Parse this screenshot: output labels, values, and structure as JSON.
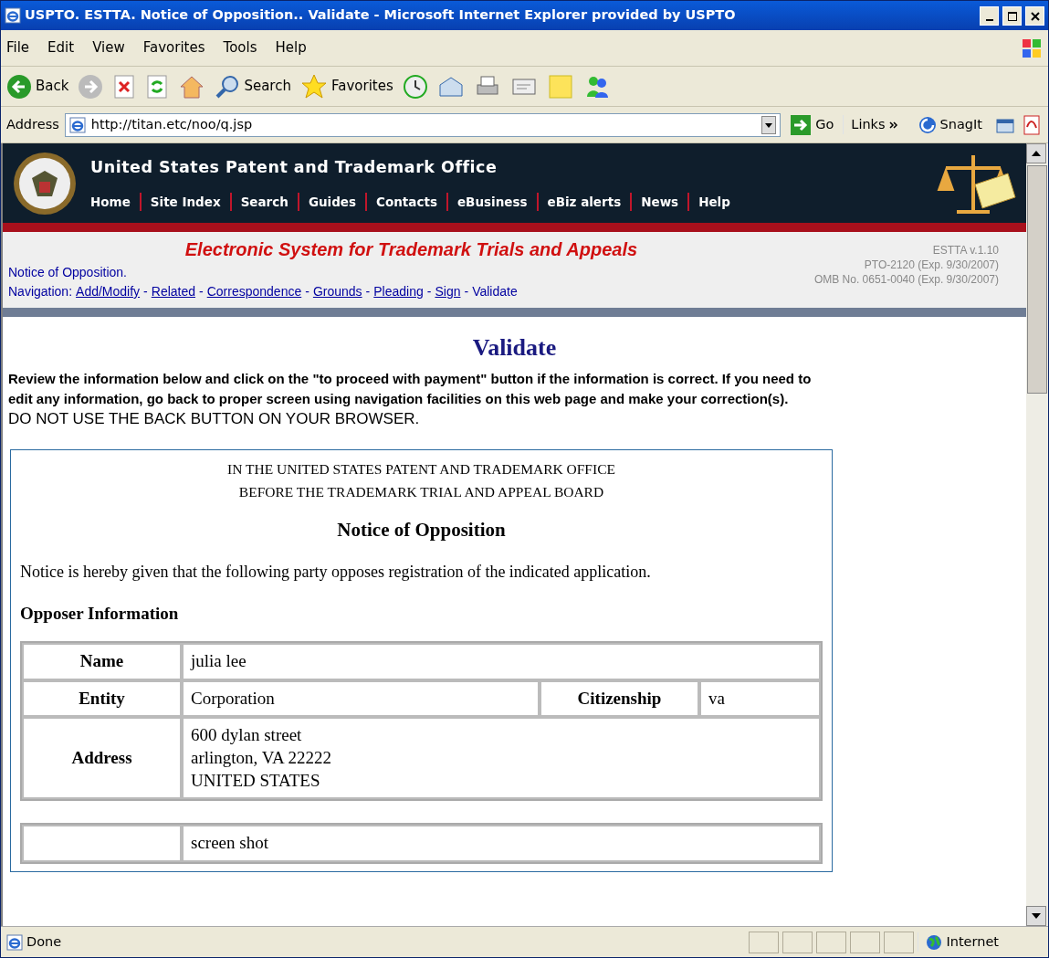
{
  "window": {
    "title": "USPTO. ESTTA. Notice of Opposition.. Validate - Microsoft Internet Explorer provided by USPTO"
  },
  "menu": [
    "File",
    "Edit",
    "View",
    "Favorites",
    "Tools",
    "Help"
  ],
  "toolbar": {
    "back": "Back",
    "search": "Search",
    "favorites": "Favorites"
  },
  "address_bar": {
    "label": "Address",
    "url": "http://titan.etc/noo/q.jsp",
    "go": "Go",
    "links": "Links",
    "snagit": "SnagIt"
  },
  "site_header": {
    "title": "United States Patent and Trademark Office",
    "nav": [
      "Home",
      "Site Index",
      "Search",
      "Guides",
      "Contacts",
      "eBusiness",
      "eBiz alerts",
      "News",
      "Help"
    ]
  },
  "banner": {
    "system_title": "Electronic System for Trademark Trials and Appeals",
    "form_name": "Notice of Opposition.",
    "nav_label": "Navigation:",
    "separator": "-",
    "nav": [
      {
        "label": "Add/Modify",
        "link": true
      },
      {
        "label": "Related",
        "link": true
      },
      {
        "label": "Correspondence",
        "link": true
      },
      {
        "label": "Grounds",
        "link": true
      },
      {
        "label": "Pleading",
        "link": true
      },
      {
        "label": "Sign",
        "link": true
      },
      {
        "label": "Validate",
        "link": false
      }
    ],
    "version_lines": [
      "ESTTA v.1.10",
      "PTO-2120 (Exp. 9/30/2007)",
      "OMB No. 0651-0040 (Exp. 9/30/2007)"
    ]
  },
  "page": {
    "heading": "Validate",
    "instructions": "Review the information below and click on the \"to proceed with payment\" button if the information is correct. If you need to edit any information, go back to proper screen using navigation facilities on this web page and make your correction(s).",
    "warning": "DO NOT USE THE BACK BUTTON ON YOUR BROWSER."
  },
  "document": {
    "court_lines": [
      "IN THE UNITED STATES PATENT AND TRADEMARK OFFICE",
      "BEFORE THE TRADEMARK TRIAL AND APPEAL BOARD"
    ],
    "heading": "Notice of Opposition",
    "intro": "Notice is hereby given that the following party opposes registration of the indicated application.",
    "section": "Opposer Information",
    "opposer": {
      "name_label": "Name",
      "name": "julia lee",
      "entity_label": "Entity",
      "entity": "Corporation",
      "citizenship_label": "Citizenship",
      "citizenship": "va",
      "address_label": "Address",
      "address": [
        "600 dylan street",
        "arlington, VA 22222",
        "UNITED STATES"
      ]
    },
    "next_table": {
      "value": "screen shot"
    }
  },
  "status_bar": {
    "text": "Done",
    "zone": "Internet"
  }
}
